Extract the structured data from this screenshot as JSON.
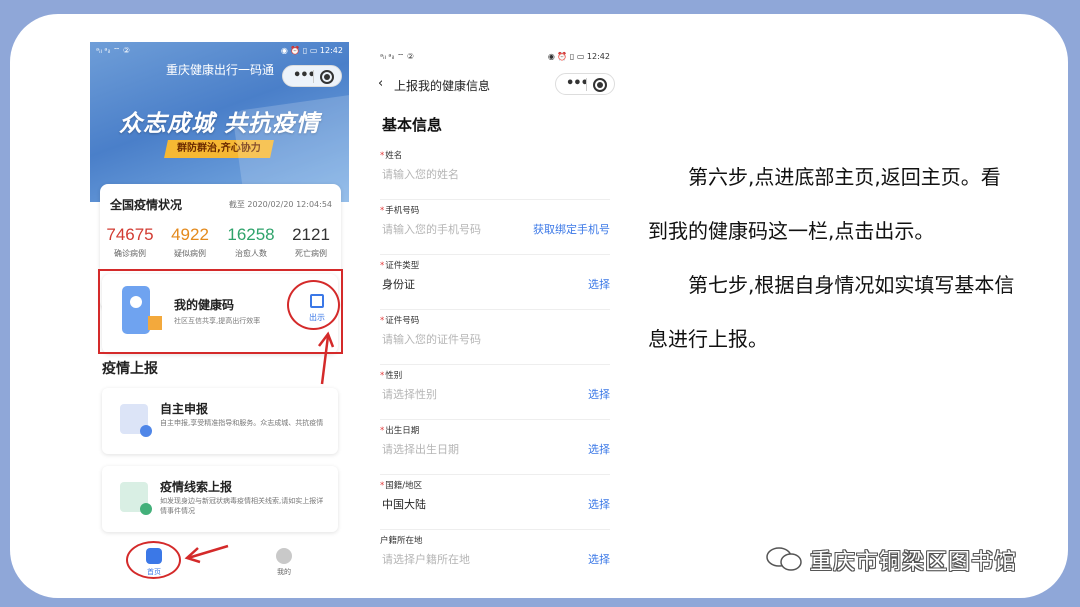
{
  "phone1": {
    "status_left": "ᵃᵢₗ ᵃᵢₗ ⌔ ②",
    "status_right": "◉ ⏰ ▯ ▭ 12:42",
    "title": "重庆健康出行一码通",
    "slogan": "众志成城 共抗疫情",
    "tag": "群防群治,齐心协力",
    "stats": {
      "title": "全国疫情状况",
      "date": "截至 2020/02/20 12:04:54",
      "items": [
        {
          "value": "74675",
          "label": "确诊病例",
          "color": "#d23b32"
        },
        {
          "value": "4922",
          "label": "疑似病例",
          "color": "#e48a1c"
        },
        {
          "value": "16258",
          "label": "治愈人数",
          "color": "#2fa36b"
        },
        {
          "value": "2121",
          "label": "死亡病例",
          "color": "#333333"
        }
      ]
    },
    "health": {
      "title": "我的健康码",
      "subtitle": "社区互信共享,提高出行效率",
      "button": "出示"
    },
    "section_title": "疫情上报",
    "reports": [
      {
        "title": "自主申报",
        "desc": "自主申报,享受精准指导和服务。众志成城、共抗疫情"
      },
      {
        "title": "疫情线索上报",
        "desc": "如发现身边与新冠状病毒疫情相关线索,请如实上报详情事件情况"
      }
    ],
    "tabs": [
      {
        "label": "首页"
      },
      {
        "label": "我的"
      }
    ]
  },
  "phone2": {
    "status_left": "ᵃᵢₗ ᵃᵢₗ ⌔ ②",
    "status_right": "◉ ⏰ ▯ ▭ 12:42",
    "title": "上报我的健康信息",
    "section": "基本信息",
    "fields": [
      {
        "label": "姓名",
        "required": true,
        "value": "请输入您的姓名",
        "placeholder": true,
        "action": ""
      },
      {
        "label": "手机号码",
        "required": true,
        "value": "请输入您的手机号码",
        "placeholder": true,
        "action": "获取绑定手机号"
      },
      {
        "label": "证件类型",
        "required": true,
        "value": "身份证",
        "placeholder": false,
        "action": "选择"
      },
      {
        "label": "证件号码",
        "required": true,
        "value": "请输入您的证件号码",
        "placeholder": true,
        "action": ""
      },
      {
        "label": "性别",
        "required": true,
        "value": "请选择性别",
        "placeholder": true,
        "action": "选择"
      },
      {
        "label": "出生日期",
        "required": true,
        "value": "请选择出生日期",
        "placeholder": true,
        "action": "选择"
      },
      {
        "label": "国籍/地区",
        "required": true,
        "value": "中国大陆",
        "placeholder": false,
        "action": "选择"
      },
      {
        "label": "户籍所在地",
        "required": false,
        "value": "请选择户籍所在地",
        "placeholder": true,
        "action": "选择"
      }
    ]
  },
  "text": {
    "p1": "第六步,点进底部主页,返回主页。看到我的健康码这一栏,点击出示。",
    "p2": "第七步,根据自身情况如实填写基本信息进行上报。"
  },
  "watermark": "重庆市铜梁区图书馆",
  "colors": {
    "background": "#8fa7d8",
    "accent": "#3b78e7",
    "highlight": "#d42a2a"
  }
}
